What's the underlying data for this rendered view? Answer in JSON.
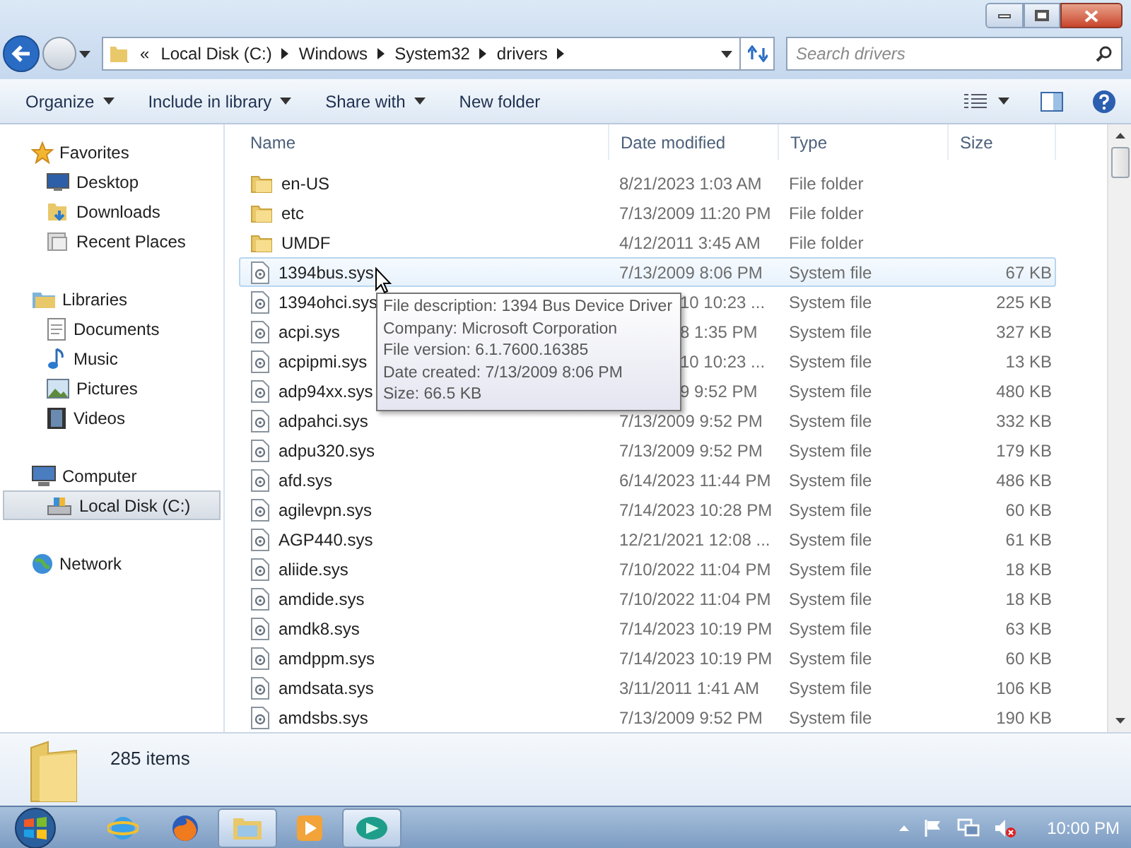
{
  "address": {
    "crumbs": [
      "«",
      "Local Disk (C:)",
      "Windows",
      "System32",
      "drivers"
    ]
  },
  "search": {
    "placeholder": "Search drivers"
  },
  "toolbar": {
    "items": [
      {
        "label": "Organize",
        "dropdown": true
      },
      {
        "label": "Include in library",
        "dropdown": true
      },
      {
        "label": "Share with",
        "dropdown": true
      },
      {
        "label": "New folder",
        "dropdown": false
      }
    ]
  },
  "sidebar": {
    "groups": [
      {
        "label": "Favorites",
        "kind": "star",
        "selected": false,
        "children": [
          {
            "label": "Desktop",
            "kind": "desktop",
            "selected": false
          },
          {
            "label": "Downloads",
            "kind": "downloads",
            "selected": false
          },
          {
            "label": "Recent Places",
            "kind": "recent",
            "selected": false
          }
        ]
      },
      {
        "label": "Libraries",
        "kind": "library",
        "selected": false,
        "children": [
          {
            "label": "Documents",
            "kind": "document",
            "selected": false
          },
          {
            "label": "Music",
            "kind": "music",
            "selected": false
          },
          {
            "label": "Pictures",
            "kind": "pictures",
            "selected": false
          },
          {
            "label": "Videos",
            "kind": "videos",
            "selected": false
          }
        ]
      },
      {
        "label": "Computer",
        "kind": "computer",
        "selected": false,
        "children": [
          {
            "label": "Local Disk (C:)",
            "kind": "disk",
            "selected": true
          }
        ]
      },
      {
        "label": "Network",
        "kind": "network",
        "selected": false
      }
    ]
  },
  "table": {
    "columns": [
      "Name",
      "Date modified",
      "Type",
      "Size"
    ],
    "rows": [
      {
        "name": "en-US",
        "kind": "folder",
        "date": "8/21/2023 1:03 AM",
        "type": "File folder",
        "hovered": false,
        "date_clipped": false
      },
      {
        "name": "etc",
        "kind": "folder",
        "date": "7/13/2009 11:20 PM",
        "type": "File folder",
        "hovered": false,
        "date_clipped": false
      },
      {
        "name": "UMDF",
        "kind": "folder",
        "date": "4/12/2011 3:45 AM",
        "type": "File folder",
        "hovered": false,
        "date_clipped": false
      },
      {
        "name": "1394bus.sys",
        "kind": "file",
        "date": "7/13/2009 8:06 PM",
        "type": "System file",
        "size": "67 KB",
        "hovered": true,
        "date_clipped": false
      },
      {
        "name": "1394ohci.sys",
        "kind": "file",
        "date": "10 10:23 ...",
        "type": "System file",
        "size": "225 KB",
        "hovered": false,
        "date_clipped": true
      },
      {
        "name": "acpi.sys",
        "kind": "file",
        "date": "8 1:35 PM",
        "type": "System file",
        "size": "327 KB",
        "hovered": false,
        "date_clipped": true
      },
      {
        "name": "acpipmi.sys",
        "kind": "file",
        "date": "10 10:23 ...",
        "type": "System file",
        "size": "13 KB",
        "hovered": false,
        "date_clipped": true
      },
      {
        "name": "adp94xx.sys",
        "kind": "file",
        "date": "9 9:52 PM",
        "type": "System file",
        "size": "480 KB",
        "hovered": false,
        "date_clipped": true
      },
      {
        "name": "adpahci.sys",
        "kind": "file",
        "date": "7/13/2009 9:52 PM",
        "type": "System file",
        "size": "332 KB",
        "hovered": false,
        "date_clipped": false
      },
      {
        "name": "adpu320.sys",
        "kind": "file",
        "date": "7/13/2009 9:52 PM",
        "type": "System file",
        "size": "179 KB",
        "hovered": false,
        "date_clipped": false
      },
      {
        "name": "afd.sys",
        "kind": "file",
        "date": "6/14/2023 11:44 PM",
        "type": "System file",
        "size": "486 KB",
        "hovered": false,
        "date_clipped": false
      },
      {
        "name": "agilevpn.sys",
        "kind": "file",
        "date": "7/14/2023 10:28 PM",
        "type": "System file",
        "size": "60 KB",
        "hovered": false,
        "date_clipped": false
      },
      {
        "name": "AGP440.sys",
        "kind": "file",
        "date": "12/21/2021 12:08 ...",
        "type": "System file",
        "size": "61 KB",
        "hovered": false,
        "date_clipped": false
      },
      {
        "name": "aliide.sys",
        "kind": "file",
        "date": "7/10/2022 11:04 PM",
        "type": "System file",
        "size": "18 KB",
        "hovered": false,
        "date_clipped": false
      },
      {
        "name": "amdide.sys",
        "kind": "file",
        "date": "7/10/2022 11:04 PM",
        "type": "System file",
        "size": "18 KB",
        "hovered": false,
        "date_clipped": false
      },
      {
        "name": "amdk8.sys",
        "kind": "file",
        "date": "7/14/2023 10:19 PM",
        "type": "System file",
        "size": "63 KB",
        "hovered": false,
        "date_clipped": false
      },
      {
        "name": "amdppm.sys",
        "kind": "file",
        "date": "7/14/2023 10:19 PM",
        "type": "System file",
        "size": "60 KB",
        "hovered": false,
        "date_clipped": false
      },
      {
        "name": "amdsata.sys",
        "kind": "file",
        "date": "3/11/2011 1:41 AM",
        "type": "System file",
        "size": "106 KB",
        "hovered": false,
        "date_clipped": false
      },
      {
        "name": "amdsbs.sys",
        "kind": "file",
        "date": "7/13/2009 9:52 PM",
        "type": "System file",
        "size": "190 KB",
        "hovered": false,
        "date_clipped": false
      }
    ]
  },
  "tooltip": {
    "lines": [
      "File description: 1394 Bus Device Driver",
      "Company: Microsoft Corporation",
      "File version: 6.1.7600.16385",
      "Date created: 7/13/2009 8:06 PM",
      "Size: 66.5 KB"
    ]
  },
  "status_bar": {
    "text": "285 items"
  },
  "taskbar": {
    "apps": [
      {
        "kind": "ie",
        "selected": false
      },
      {
        "kind": "firefox",
        "selected": false
      },
      {
        "kind": "explorer",
        "selected": true
      },
      {
        "kind": "media",
        "selected": false
      },
      {
        "kind": "app",
        "selected": true
      }
    ],
    "clock": "10:00 PM"
  }
}
